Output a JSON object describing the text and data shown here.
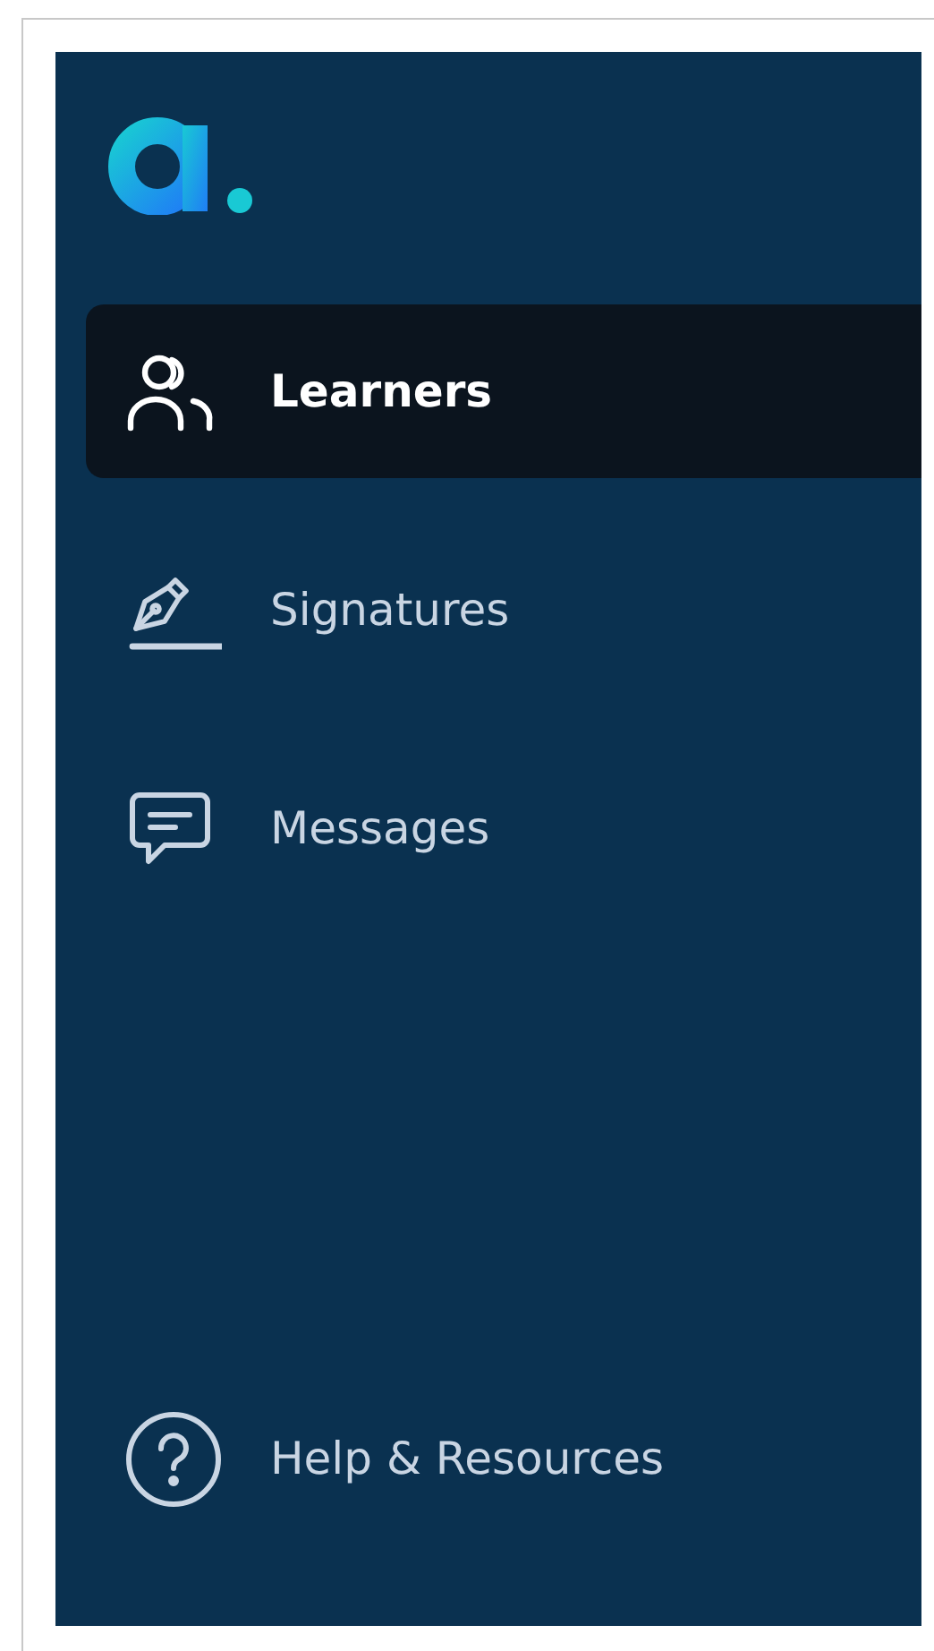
{
  "sidebar": {
    "items": [
      {
        "label": "Learners",
        "selected": true
      },
      {
        "label": "Signatures",
        "selected": false
      },
      {
        "label": "Messages",
        "selected": false
      }
    ],
    "footer_item": {
      "label": "Help & Resources"
    }
  }
}
